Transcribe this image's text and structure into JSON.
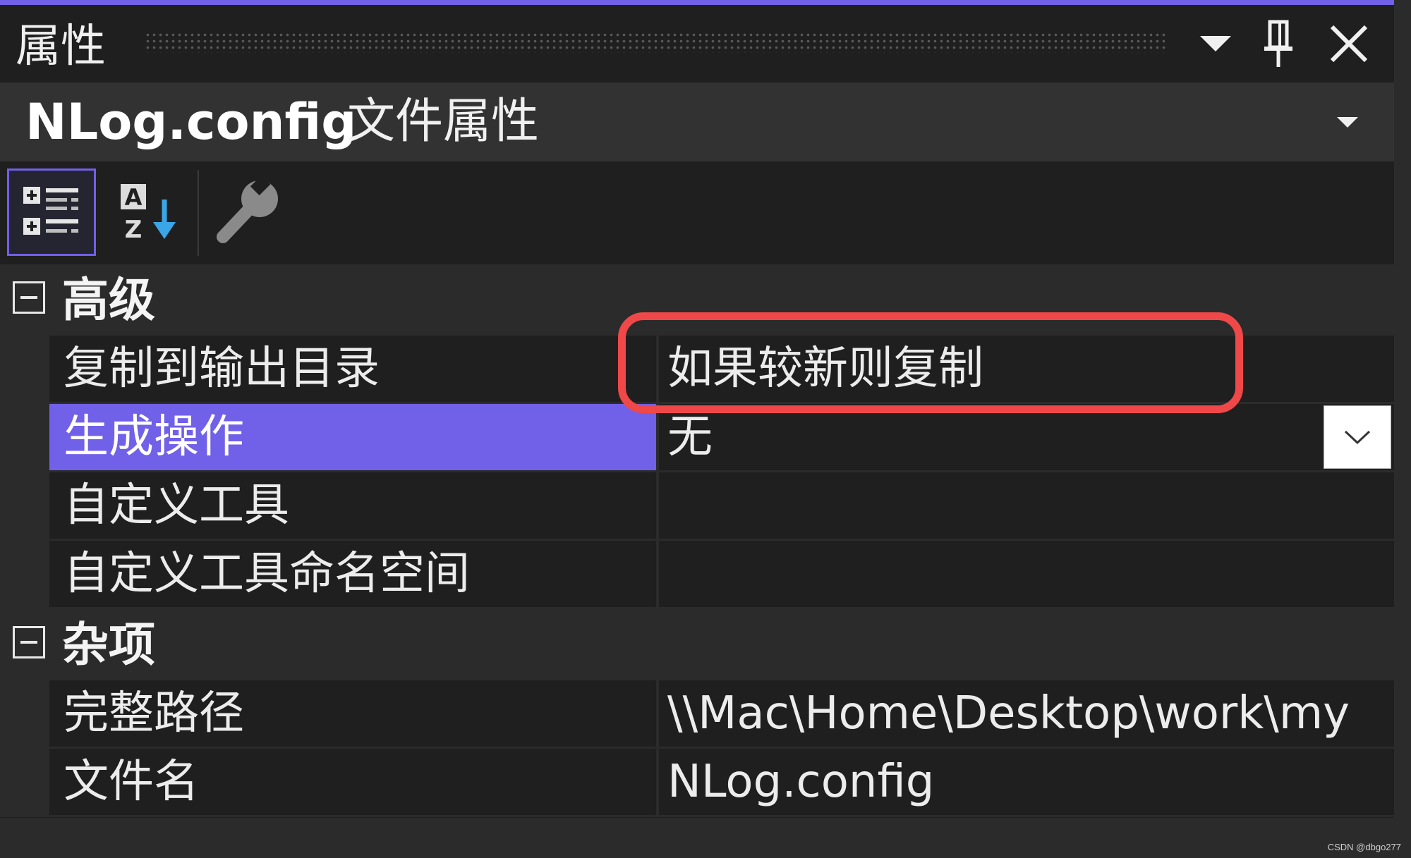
{
  "panel": {
    "title": "属性",
    "accent_color": "#7160e8",
    "buttons": {
      "dropdown_icon": "chevron-down-icon",
      "pin_icon": "pin-icon",
      "close_icon": "close-icon"
    }
  },
  "object_selector": {
    "name": "NLog.config",
    "type": "文件属性"
  },
  "toolbar": {
    "items": [
      "categorized-view-icon",
      "alphabetical-sort-icon",
      "property-pages-icon"
    ],
    "active": "categorized-view-icon"
  },
  "categories": [
    {
      "label": "高级",
      "properties": [
        {
          "name": "复制到输出目录",
          "value": "如果较新则复制"
        },
        {
          "name": "生成操作",
          "value": "无",
          "selected": true,
          "has_dropdown": true
        },
        {
          "name": "自定义工具",
          "value": ""
        },
        {
          "name": "自定义工具命名空间",
          "value": ""
        }
      ]
    },
    {
      "label": "杂项",
      "properties": [
        {
          "name": "完整路径",
          "value": "\\\\Mac\\Home\\Desktop\\work\\my"
        },
        {
          "name": "文件名",
          "value": "NLog.config"
        }
      ]
    }
  ],
  "annotation": {
    "color": "#f04848"
  },
  "watermark": "CSDN @dbgo277"
}
